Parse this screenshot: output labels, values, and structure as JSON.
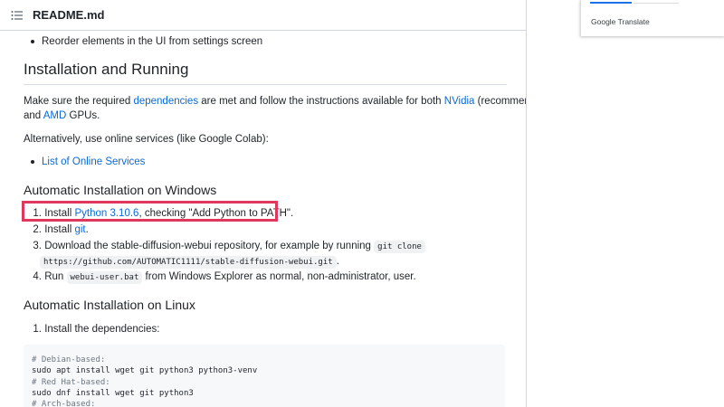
{
  "readme": {
    "title": "README.md",
    "top_bullet": "Reorder elements in the UI from settings screen",
    "install_heading": "Installation and Running",
    "p1_pre": "Make sure the required ",
    "p1_link1": "dependencies",
    "p1_mid": " are met and follow the instructions available for both ",
    "p1_link2": "NVidia",
    "p1_post": " (recommended)",
    "p1b_pre": "and ",
    "p1b_link": "AMD",
    "p1b_post": " GPUs.",
    "p2": "Alternatively, use online services (like Google Colab):",
    "online_link": "List of Online Services",
    "win_heading": "Automatic Installation on Windows",
    "win_steps": {
      "s1_num": "1.",
      "s1_pre": "Install ",
      "s1_link": "Python 3.10.6",
      "s1_post": ", checking \"Add Python to PATH\".",
      "s2_num": "2.",
      "s2_pre": "Install ",
      "s2_link": "git",
      "s2_post": ".",
      "s3_num": "3.",
      "s3_pre": "Download the stable-diffusion-webui repository, for example by running ",
      "s3_code1": "git clone",
      "s3_code2": "https://github.com/AUTOMATIC1111/stable-diffusion-webui.git",
      "s3_post": ".",
      "s4_num": "4.",
      "s4_pre": "Run ",
      "s4_code": "webui-user.bat",
      "s4_post": " from Windows Explorer as normal, non-administrator, user."
    },
    "linux_heading": "Automatic Installation on Linux",
    "linux_step1_num": "1.",
    "linux_step1": "Install the dependencies:",
    "code_lines": {
      "l1": "# Debian-based:",
      "l2": "sudo apt install wget git python3 python3-venv",
      "l3": "# Red Hat-based:",
      "l4": "sudo dnf install wget git python3",
      "l5": "# Arch-based:"
    }
  },
  "translate": {
    "label": "Google Translate"
  },
  "colors": {
    "link": "#0969da",
    "highlight": "#e0385c"
  }
}
